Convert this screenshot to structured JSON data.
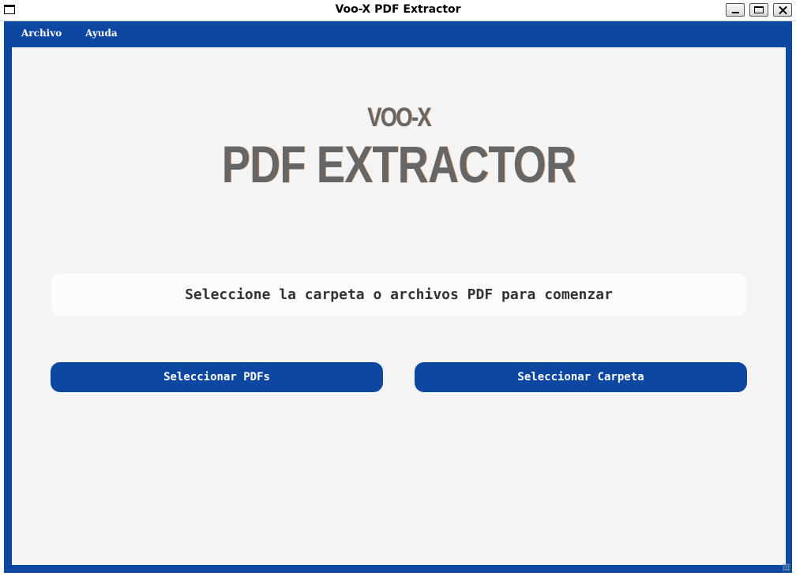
{
  "window": {
    "title": "Voo-X PDF Extractor"
  },
  "menu": {
    "items": [
      {
        "label": "Archivo"
      },
      {
        "label": "Ayuda"
      }
    ]
  },
  "logo": {
    "line1": "VOO-X",
    "line2": "PDF EXTRACTOR"
  },
  "status": {
    "message": "Seleccione la carpeta o archivos PDF para comenzar"
  },
  "actions": {
    "select_pdfs": "Seleccionar PDFs",
    "select_folder": "Seleccionar Carpeta"
  },
  "colors": {
    "accent": "#0d47a1",
    "background": "#f4f4f4",
    "logo_text": "#666666"
  }
}
